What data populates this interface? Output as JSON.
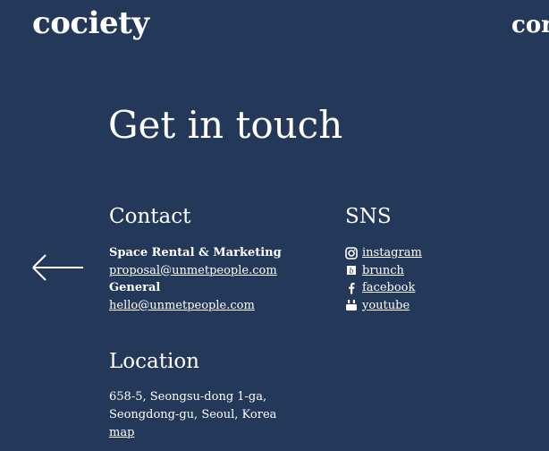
{
  "header": {
    "logo": "cociety",
    "logo_partial": "cor"
  },
  "main": {
    "title": "Get in touch",
    "contact": {
      "heading": "Contact",
      "groups": [
        {
          "label": "Space Rental & Marketing",
          "email": "proposal@unmetpeople.com"
        },
        {
          "label": "General",
          "email": "hello@unmetpeople.com"
        }
      ]
    },
    "sns": {
      "heading": "SNS",
      "items": [
        {
          "label": "instagram",
          "icon": "instagram-icon"
        },
        {
          "label": "brunch",
          "icon": "brunch-icon"
        },
        {
          "label": "facebook",
          "icon": "facebook-icon"
        },
        {
          "label": "youtube",
          "icon": "youtube-icon"
        }
      ]
    },
    "location": {
      "heading": "Location",
      "address_line1": "658-5, Seongsu-dong 1-ga,",
      "address_line2": "Seongdong-gu, Seoul, Korea",
      "map_label": "map"
    }
  },
  "colors": {
    "background": "#24385a",
    "text": "#ffffff"
  },
  "icons": {
    "back": "left-arrow-icon"
  }
}
